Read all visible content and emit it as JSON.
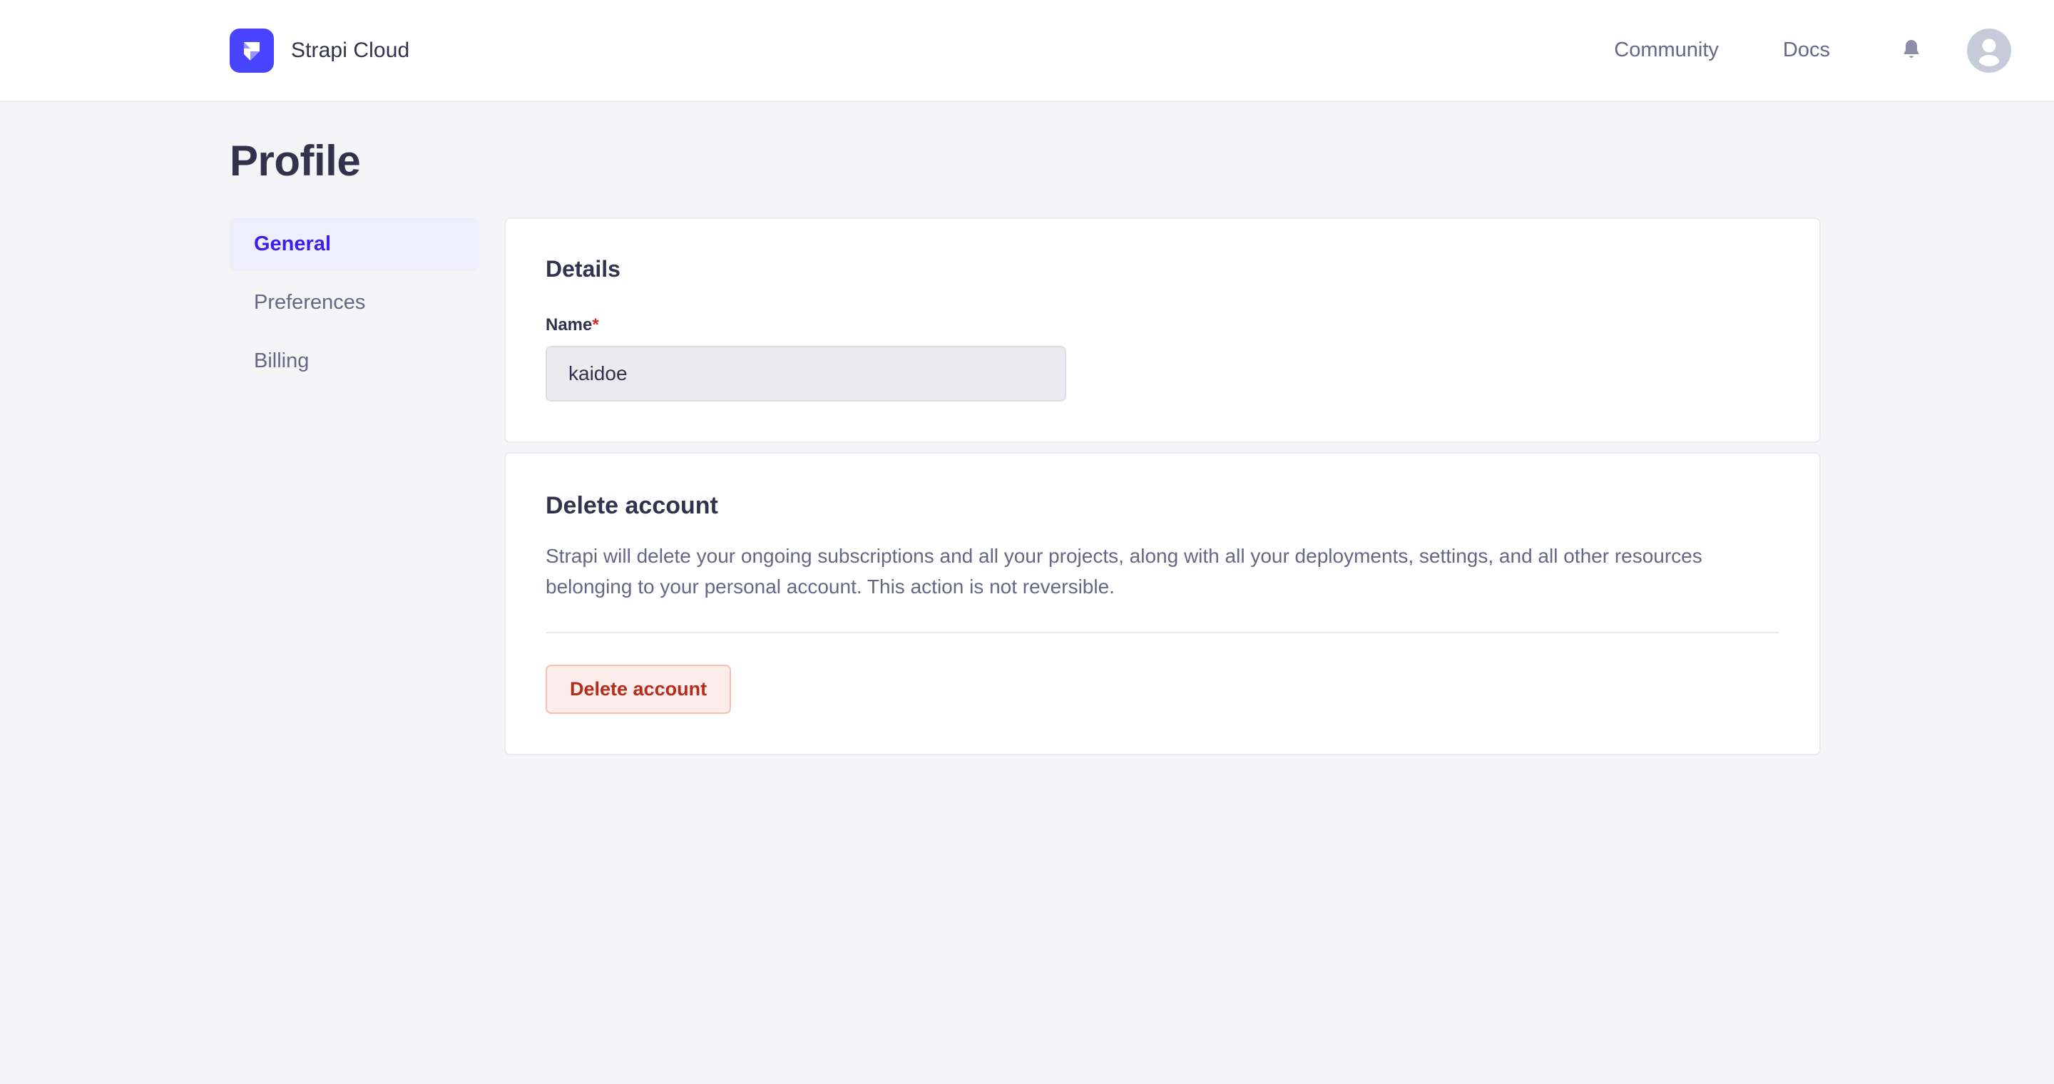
{
  "header": {
    "brand_name": "Strapi Cloud",
    "logo_icon": "strapi-logo-icon",
    "nav": [
      {
        "label": "Community",
        "name": "nav-link-community"
      },
      {
        "label": "Docs",
        "name": "nav-link-docs"
      }
    ],
    "bell_icon": "bell-icon",
    "avatar_icon": "user-avatar-icon"
  },
  "page": {
    "title": "Profile"
  },
  "sidebar": {
    "items": [
      {
        "label": "General",
        "active": true
      },
      {
        "label": "Preferences",
        "active": false
      },
      {
        "label": "Billing",
        "active": false
      }
    ]
  },
  "details_card": {
    "title": "Details",
    "name_label": "Name",
    "required_marker": "*",
    "name_value": "kaidoe",
    "name_placeholder": "Name"
  },
  "delete_card": {
    "title": "Delete account",
    "description": "Strapi will delete your ongoing subscriptions and all your projects, along with all your deployments, settings, and all other resources belonging to your personal account. This action is not reversible.",
    "button_label": "Delete account"
  },
  "colors": {
    "brand": "#4945FF",
    "active_accent": "#3B1FEE",
    "active_bg": "#EEEEFC",
    "danger_text": "#B72B1A",
    "danger_bg": "#FCECEA",
    "danger_border": "#F5C0B8",
    "required": "#D02B20",
    "page_bg": "#F5F5F8",
    "text_primary": "#32324D",
    "text_secondary": "#666687",
    "border": "#EAEAEF"
  }
}
